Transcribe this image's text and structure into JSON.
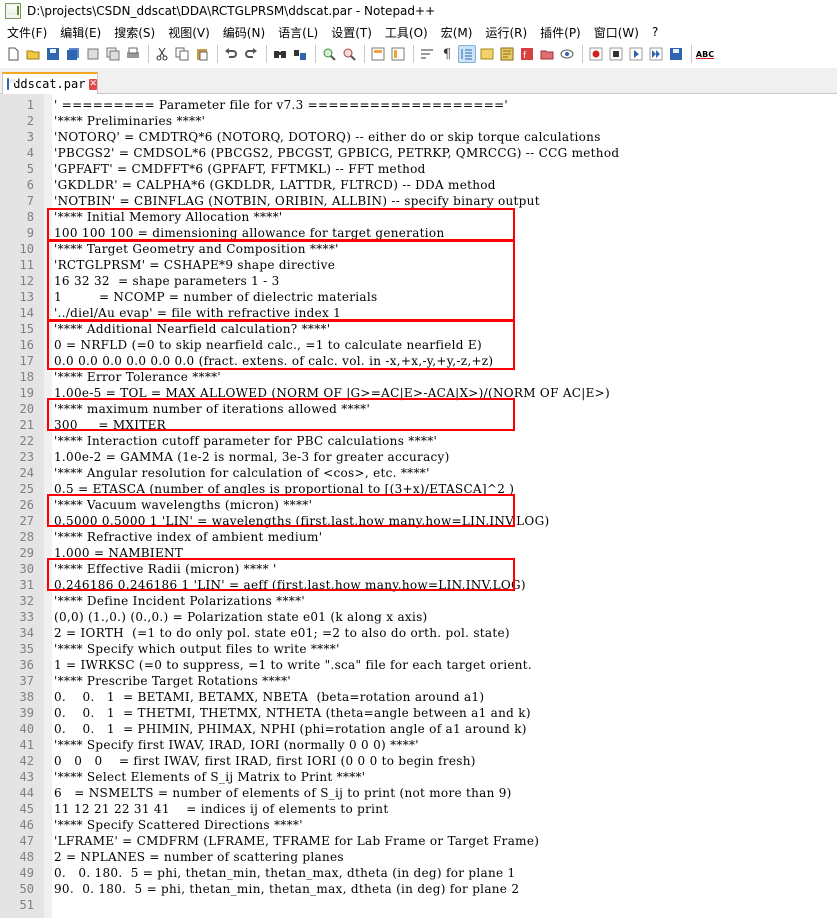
{
  "window": {
    "title": "D:\\projects\\CSDN_ddscat\\DDA\\RCTGLPRSM\\ddscat.par - Notepad++"
  },
  "menu": [
    "文件(F)",
    "编辑(E)",
    "搜索(S)",
    "视图(V)",
    "编码(N)",
    "语言(L)",
    "设置(T)",
    "工具(O)",
    "宏(M)",
    "运行(R)",
    "插件(P)",
    "窗口(W)",
    "?"
  ],
  "toolbar": {
    "icons": [
      "new-file-icon",
      "open-file-icon",
      "save-icon",
      "save-all-icon",
      "close-icon",
      "close-all-icon",
      "print-icon",
      "cut-icon",
      "copy-icon",
      "paste-icon",
      "undo-icon",
      "redo-icon",
      "find-icon",
      "replace-icon",
      "zoom-in-icon",
      "zoom-out-icon",
      "sync-vertical-icon",
      "sync-horizontal-icon",
      "word-wrap-icon",
      "show-all-chars-icon",
      "indent-guide-icon",
      "udl-icon",
      "doc-map-icon",
      "function-list-icon",
      "folder-workspace-icon",
      "monitoring-icon",
      "record-macro-icon",
      "stop-record-icon",
      "play-macro-icon",
      "play-multiple-icon",
      "save-macro-icon",
      "spell-check-icon"
    ],
    "spell_label": "ABC"
  },
  "tab": {
    "label": "ddscat.par",
    "close": "✕"
  },
  "colors": {
    "highlight_border": "#ff0000",
    "tab_accent": "#f5a623",
    "gutter_bg": "#e4e4e4"
  },
  "lines": [
    {
      "n": "1",
      "text": "' ========= Parameter file for v7.3 ==================='"
    },
    {
      "n": "2",
      "text": "'**** Preliminaries ****'"
    },
    {
      "n": "3",
      "text": "'NOTORQ' = CMDTRQ*6 (NOTORQ, DOTORQ) -- either do or skip torque calculations"
    },
    {
      "n": "4",
      "text": "'PBCGS2' = CMDSOL*6 (PBCGS2, PBCGST, GPBICG, PETRKP, QMRCCG) -- CCG method"
    },
    {
      "n": "5",
      "text": "'GPFAFT' = CMDFFT*6 (GPFAFT, FFTMKL) -- FFT method"
    },
    {
      "n": "6",
      "text": "'GKDLDR' = CALPHA*6 (GKDLDR, LATTDR, FLTRCD) -- DDA method"
    },
    {
      "n": "7",
      "text": "'NOTBIN' = CBINFLAG (NOTBIN, ORIBIN, ALLBIN) -- specify binary output"
    },
    {
      "n": "8",
      "text": "'**** Initial Memory Allocation ****'"
    },
    {
      "n": "9",
      "text": "100 100 100 = dimensioning allowance for target generation"
    },
    {
      "n": "10",
      "text": "'**** Target Geometry and Composition ****'"
    },
    {
      "n": "11",
      "text": "'RCTGLPRSM' = CSHAPE*9 shape directive"
    },
    {
      "n": "12",
      "text": "16 32 32  = shape parameters 1 - 3"
    },
    {
      "n": "13",
      "text": "1         = NCOMP = number of dielectric materials"
    },
    {
      "n": "14",
      "text": "'../diel/Au evap' = file with refractive index 1"
    },
    {
      "n": "15",
      "text": "'**** Additional Nearfield calculation? ****'"
    },
    {
      "n": "16",
      "text": "0 = NRFLD (=0 to skip nearfield calc., =1 to calculate nearfield E)"
    },
    {
      "n": "17",
      "text": "0.0 0.0 0.0 0.0 0.0 0.0 (fract. extens. of calc. vol. in -x,+x,-y,+y,-z,+z)"
    },
    {
      "n": "18",
      "text": "'**** Error Tolerance ****'"
    },
    {
      "n": "19",
      "text": "1.00e-5 = TOL = MAX ALLOWED (NORM OF |G>=AC|E>-ACA|X>)/(NORM OF AC|E>)"
    },
    {
      "n": "20",
      "text": "'**** maximum number of iterations allowed ****'"
    },
    {
      "n": "21",
      "text": "300     = MXITER"
    },
    {
      "n": "22",
      "text": "'**** Interaction cutoff parameter for PBC calculations ****'"
    },
    {
      "n": "23",
      "text": "1.00e-2 = GAMMA (1e-2 is normal, 3e-3 for greater accuracy)"
    },
    {
      "n": "24",
      "text": "'**** Angular resolution for calculation of <cos>, etc. ****'"
    },
    {
      "n": "25",
      "text": "0.5 = ETASCA (number of angles is proportional to [(3+x)/ETASCA]^2 )"
    },
    {
      "n": "26",
      "text": "'**** Vacuum wavelengths (micron) ****'"
    },
    {
      "n": "27",
      "text": "0.5000 0.5000 1 'LIN' = wavelengths (first,last,how many,how=LIN,INV,LOG)"
    },
    {
      "n": "28",
      "text": "'**** Refractive index of ambient medium'"
    },
    {
      "n": "29",
      "text": "1.000 = NAMBIENT"
    },
    {
      "n": "30",
      "text": "'**** Effective Radii (micron) **** '"
    },
    {
      "n": "31",
      "text": "0.246186 0.246186 1 'LIN' = aeff (first,last,how many,how=LIN,INV,LOG)"
    },
    {
      "n": "32",
      "text": "'**** Define Incident Polarizations ****'"
    },
    {
      "n": "33",
      "text": "(0,0) (1.,0.) (0.,0.) = Polarization state e01 (k along x axis)"
    },
    {
      "n": "34",
      "text": "2 = IORTH  (=1 to do only pol. state e01; =2 to also do orth. pol. state)"
    },
    {
      "n": "35",
      "text": "'**** Specify which output files to write ****'"
    },
    {
      "n": "36",
      "text": "1 = IWRKSC (=0 to suppress, =1 to write \".sca\" file for each target orient."
    },
    {
      "n": "37",
      "text": "'**** Prescribe Target Rotations ****'"
    },
    {
      "n": "38",
      "text": "0.    0.   1  = BETAMI, BETAMX, NBETA  (beta=rotation around a1)"
    },
    {
      "n": "39",
      "text": "0.    0.   1  = THETMI, THETMX, NTHETA (theta=angle between a1 and k)"
    },
    {
      "n": "40",
      "text": "0.    0.   1  = PHIMIN, PHIMAX, NPHI (phi=rotation angle of a1 around k)"
    },
    {
      "n": "41",
      "text": "'**** Specify first IWAV, IRAD, IORI (normally 0 0 0) ****'"
    },
    {
      "n": "42",
      "text": "0   0   0    = first IWAV, first IRAD, first IORI (0 0 0 to begin fresh)"
    },
    {
      "n": "43",
      "text": "'**** Select Elements of S_ij Matrix to Print ****'"
    },
    {
      "n": "44",
      "text": "6   = NSMELTS = number of elements of S_ij to print (not more than 9)"
    },
    {
      "n": "45",
      "text": "11 12 21 22 31 41    = indices ij of elements to print"
    },
    {
      "n": "46",
      "text": "'**** Specify Scattered Directions ****'"
    },
    {
      "n": "47",
      "text": "'LFRAME' = CMDFRM (LFRAME, TFRAME for Lab Frame or Target Frame)"
    },
    {
      "n": "48",
      "text": "2 = NPLANES = number of scattering planes"
    },
    {
      "n": "49",
      "text": "0.   0. 180.  5 = phi, thetan_min, thetan_max, dtheta (in deg) for plane 1"
    },
    {
      "n": "50",
      "text": "90.  0. 180.  5 = phi, thetan_min, thetan_max, dtheta (in deg) for plane 2"
    },
    {
      "n": "51",
      "text": ""
    }
  ]
}
